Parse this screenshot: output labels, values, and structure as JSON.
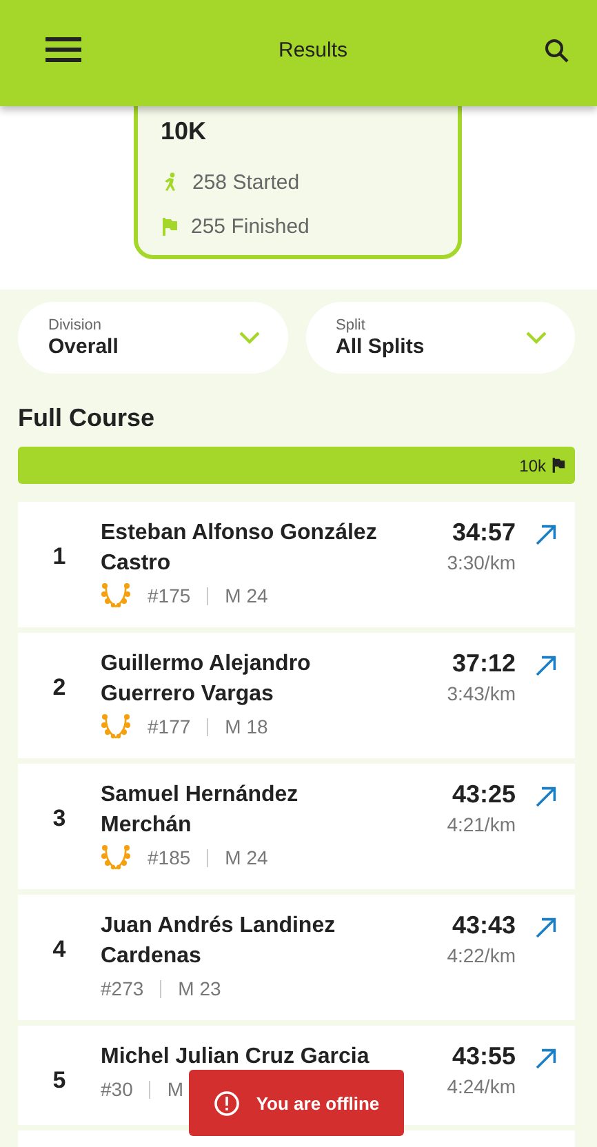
{
  "app_bar": {
    "title": "Results"
  },
  "race": {
    "name": "10K",
    "started": "258 Started",
    "finished": "255 Finished"
  },
  "filters": [
    {
      "label": "Division",
      "value": "Overall"
    },
    {
      "label": "Split",
      "value": "All Splits"
    }
  ],
  "section": {
    "title": "Full Course",
    "marker": "10k"
  },
  "results": [
    {
      "rank": "1",
      "name": "Esteban Alfonso González Castro",
      "podium": true,
      "bib": "#175",
      "category": "M 24",
      "time": "34:57",
      "pace": "3:30/km"
    },
    {
      "rank": "2",
      "name": "Guillermo Alejandro Guerrero Vargas",
      "podium": true,
      "bib": "#177",
      "category": "M 18",
      "time": "37:12",
      "pace": "3:43/km"
    },
    {
      "rank": "3",
      "name": "Samuel Hernández Merchán",
      "podium": true,
      "bib": "#185",
      "category": "M 24",
      "time": "43:25",
      "pace": "4:21/km"
    },
    {
      "rank": "4",
      "name": "Juan Andrés Landinez Cardenas",
      "podium": false,
      "bib": "#273",
      "category": "M 23",
      "time": "43:43",
      "pace": "4:22/km"
    },
    {
      "rank": "5",
      "name": "Michel Julian Cruz Garcia",
      "podium": false,
      "bib": "#30",
      "category": "M",
      "time": "43:55",
      "pace": "4:24/km"
    }
  ],
  "toast": {
    "message": "You are offline"
  }
}
